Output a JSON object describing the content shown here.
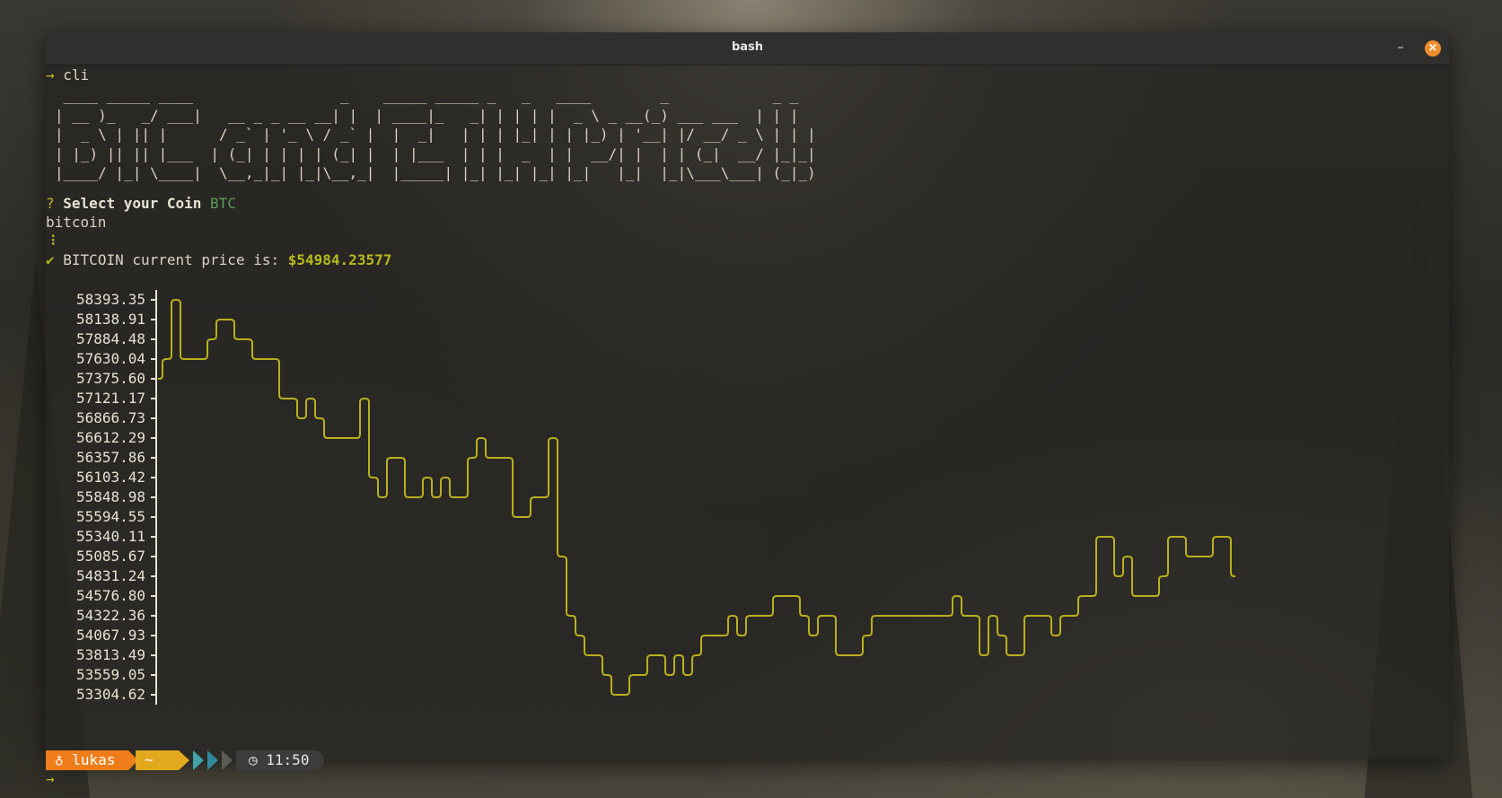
{
  "window": {
    "title": "bash",
    "minimize_label": "–",
    "close_label": "×"
  },
  "terminal": {
    "prompt_arrow": "→",
    "command": "cli",
    "ascii_banner": " ____ _____ ____                 _    _____ _____ _   _   ____        _            _ _ \n| __ )_   _/ ___|   __ _ _ __ __| |  | ____|_   _| | | | |  _ \\ _ __(_) ___ ___  | | |\n|  _ \\ | || |      / _` | '_ \\ / _` |  |  _|   | | | |_| | | |_) | '__| |/ __/ _ \\ | | |\n| |_) || || |___  | (_| | | | | (_| |  | |___  | | |  _  | |  __/| |  | | (_|  __/ |_|_|\n|____/ |_| \\____|  \\__,_|_| |_|\\__,_|  |_____| |_| |_| |_| |_|   |_|  |_|\\___\\___| (_|_)",
    "question_mark": "?",
    "question": "Select your Coin",
    "answer": "BTC",
    "coin_name": "bitcoin",
    "spinner": "⠸",
    "checkmark": "✔",
    "price_text": "BITCOIN current price is:",
    "price_value": "$54984.23577",
    "bottom_prompt_arrow": "→"
  },
  "status_prompt": {
    "user_icon": "linux-icon",
    "user": "lukas",
    "user_glyph": "♁",
    "dir": "~",
    "clock_icon": "clock-icon",
    "clock_glyph": "◷",
    "time": "11:50",
    "colors": {
      "user_bg": "#ef7d1a",
      "dir_bg": "#e2a91c",
      "chevron_1": "#3fa3a8",
      "chevron_2": "#2f8a9e",
      "time_bg": "#3c3c3a"
    }
  },
  "chart_data": {
    "type": "line",
    "color": "#b8b01c",
    "grid": false,
    "ytick_labels": [
      "58393.35",
      "58138.91",
      "57884.48",
      "57630.04",
      "57375.60",
      "57121.17",
      "56866.73",
      "56612.29",
      "56357.86",
      "56103.42",
      "55848.98",
      "55594.55",
      "55340.11",
      "55085.67",
      "54831.24",
      "54576.80",
      "54322.36",
      "54067.93",
      "53813.49",
      "53559.05",
      "53304.62"
    ],
    "ylim": [
      53304.62,
      58393.35
    ],
    "values": [
      57375.6,
      57630.04,
      58393.35,
      57630.04,
      57630.04,
      57630.04,
      57884.48,
      58138.91,
      58138.91,
      57884.48,
      57884.48,
      57630.04,
      57630.04,
      57630.04,
      57121.17,
      57121.17,
      56866.73,
      57121.17,
      56866.73,
      56612.29,
      56612.29,
      56612.29,
      56612.29,
      57121.17,
      56103.42,
      55848.98,
      56357.86,
      56357.86,
      55848.98,
      55848.98,
      56103.42,
      55848.98,
      56103.42,
      55848.98,
      55848.98,
      56357.86,
      56612.29,
      56357.86,
      56357.86,
      56357.86,
      55594.55,
      55594.55,
      55848.98,
      55848.98,
      56612.29,
      55085.67,
      54322.36,
      54067.93,
      53813.49,
      53813.49,
      53559.05,
      53304.62,
      53304.62,
      53559.05,
      53559.05,
      53813.49,
      53813.49,
      53559.05,
      53813.49,
      53559.05,
      53813.49,
      54067.93,
      54067.93,
      54067.93,
      54322.36,
      54067.93,
      54322.36,
      54322.36,
      54322.36,
      54576.8,
      54576.8,
      54576.8,
      54322.36,
      54067.93,
      54322.36,
      54322.36,
      53813.49,
      53813.49,
      53813.49,
      54067.93,
      54322.36,
      54322.36,
      54322.36,
      54322.36,
      54322.36,
      54322.36,
      54322.36,
      54322.36,
      54322.36,
      54576.8,
      54322.36,
      54322.36,
      53813.49,
      54322.36,
      54067.93,
      53813.49,
      53813.49,
      54322.36,
      54322.36,
      54322.36,
      54067.93,
      54322.36,
      54322.36,
      54576.8,
      54576.8,
      55340.11,
      55340.11,
      54831.24,
      55085.67,
      54576.8,
      54576.8,
      54576.8,
      54831.24,
      55340.11,
      55340.11,
      55085.67,
      55085.67,
      55085.67,
      55340.11,
      55340.11,
      54831.24
    ]
  }
}
